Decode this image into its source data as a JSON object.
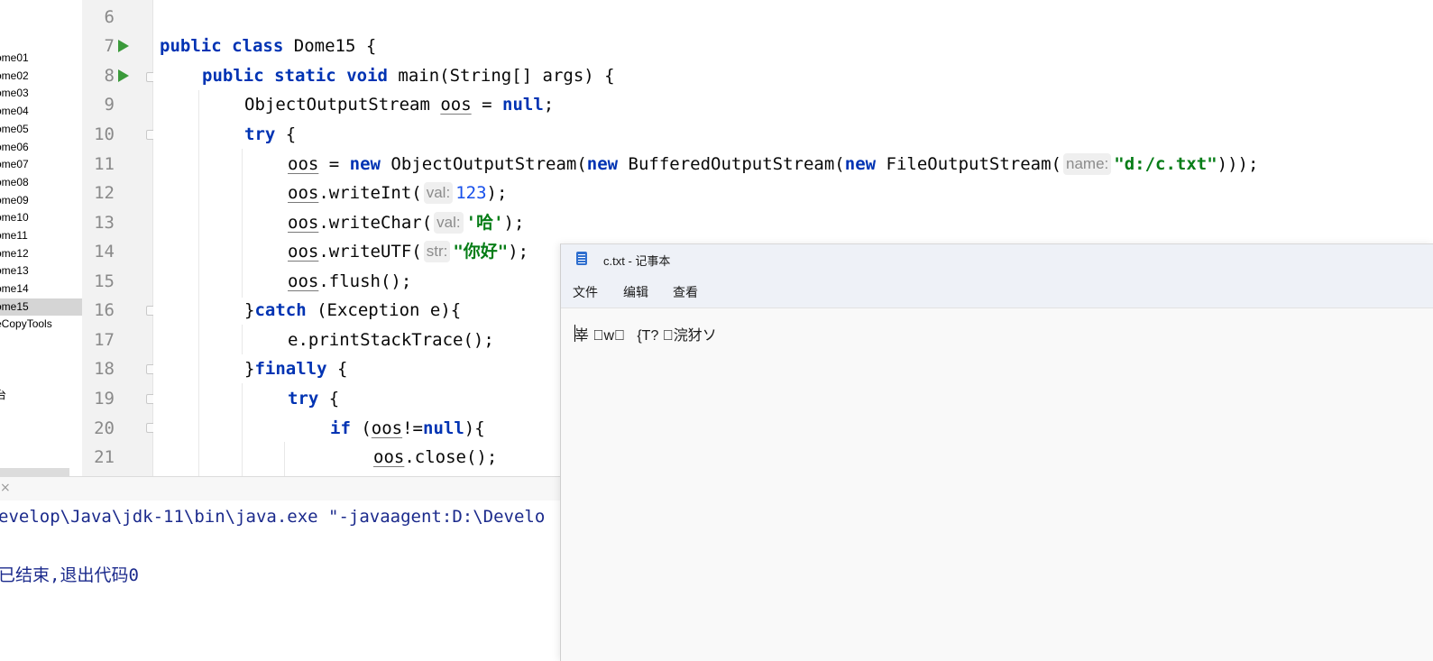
{
  "project_tree": {
    "items": [
      {
        "label": "ome01",
        "selected": false
      },
      {
        "label": "ome02",
        "selected": false
      },
      {
        "label": "ome03",
        "selected": false
      },
      {
        "label": "ome04",
        "selected": false
      },
      {
        "label": "ome05",
        "selected": false
      },
      {
        "label": "ome06",
        "selected": false
      },
      {
        "label": "ome07",
        "selected": false
      },
      {
        "label": "ome08",
        "selected": false
      },
      {
        "label": "ome09",
        "selected": false
      },
      {
        "label": "ome10",
        "selected": false
      },
      {
        "label": "ome11",
        "selected": false
      },
      {
        "label": "ome12",
        "selected": false
      },
      {
        "label": "ome13",
        "selected": false
      },
      {
        "label": "ome14",
        "selected": false
      },
      {
        "label": "ome15",
        "selected": true
      },
      {
        "label": "eCopyTools",
        "selected": false
      },
      {
        "label": "台",
        "selected": false
      }
    ]
  },
  "editor": {
    "line_numbers": [
      "6",
      "7",
      "8",
      "9",
      "10",
      "11",
      "12",
      "13",
      "14",
      "15",
      "16",
      "17",
      "18",
      "19",
      "20",
      "21"
    ],
    "lines": {
      "l7": {
        "kw1": "public",
        "kw2": "class",
        "rest": "Dome15 {"
      },
      "l8": {
        "kw1": "public",
        "kw2": "static",
        "kw3": "void",
        "rest": "main(String[] args) {"
      },
      "l9": {
        "t1": "ObjectOutputStream ",
        "var": "oos",
        "t2": " = ",
        "kw": "null",
        "t3": ";"
      },
      "l10": {
        "kw": "try",
        "rest": " {"
      },
      "l11": {
        "var": "oos",
        "t1": " = ",
        "kw1": "new",
        "t2": " ObjectOutputStream(",
        "kw2": "new",
        "t3": " BufferedOutputStream(",
        "kw3": "new",
        "t4": " FileOutputStream(",
        "hint": "name:",
        "str": "\"d:/c.txt\"",
        "t5": ")));"
      },
      "l12": {
        "var": "oos",
        "t1": ".writeInt(",
        "hint": "val:",
        "num": "123",
        "t2": ");"
      },
      "l13": {
        "var": "oos",
        "t1": ".writeChar(",
        "hint": "val:",
        "str": "'哈'",
        "t2": ");"
      },
      "l14": {
        "var": "oos",
        "t1": ".writeUTF(",
        "hint": "str:",
        "str": "\"你好\"",
        "t2": ");"
      },
      "l15": {
        "var": "oos",
        "t1": ".flush();"
      },
      "l16": {
        "t1": "}",
        "kw": "catch",
        "t2": " (Exception e){"
      },
      "l17": {
        "t1": "e.printStackTrace();"
      },
      "l18": {
        "t1": "}",
        "kw": "finally",
        "t2": " {"
      },
      "l19": {
        "kw": "try",
        "rest": " {"
      },
      "l20": {
        "kw1": "if",
        "t1": " (",
        "var": "oos",
        "t2": "!=",
        "kw2": "null",
        "t3": "){"
      },
      "l21": {
        "var": "oos",
        "t1": ".close();"
      }
    }
  },
  "console": {
    "close_icon": "×",
    "command_line": "evelop\\Java\\jdk-11\\bin\\java.exe \"-javaagent:D:\\Develo",
    "exit_line": "已结束,退出代码0"
  },
  "notepad": {
    "title": "c.txt - 记事本",
    "menu": [
      "文件",
      "编辑",
      "查看"
    ],
    "content": "峷 \u0000w\u0000   {T? \u0000浣犲ソ",
    "icon": "notepad-icon"
  },
  "colors": {
    "keyword": "#0033b3",
    "string": "#067d17",
    "number": "#1750eb",
    "console_text": "#1b2a8c",
    "run_icon": "#3a9a3a"
  }
}
